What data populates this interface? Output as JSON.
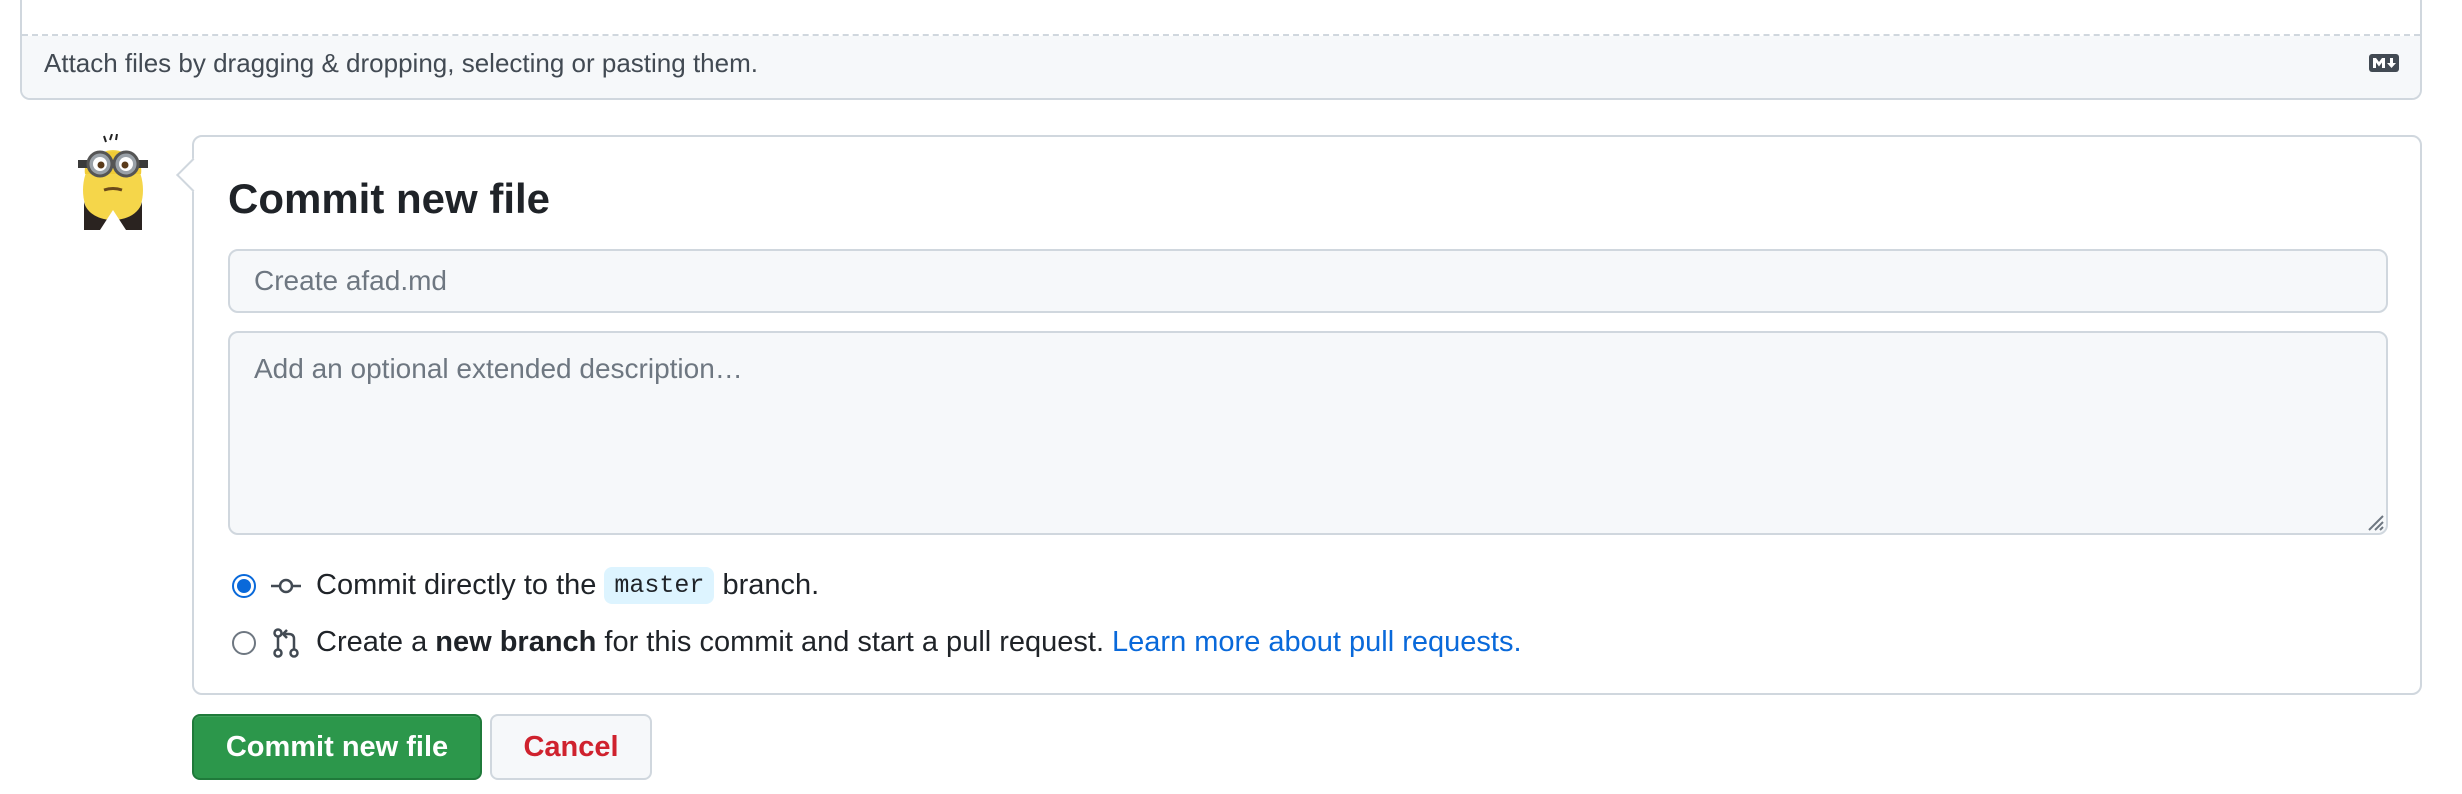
{
  "attach": {
    "text": "Attach files by dragging & dropping, selecting or pasting them.",
    "markdown_icon": "markdown-icon"
  },
  "avatar": {
    "icon": "minion-avatar-icon"
  },
  "commit": {
    "title": "Commit new file",
    "summary_placeholder": "Create afad.md",
    "summary_value": "",
    "description_placeholder": "Add an optional extended description…",
    "description_value": "",
    "option_direct": {
      "selected": true,
      "icon": "git-commit-icon",
      "text_before": "Commit directly to the",
      "branch": "master",
      "text_after": "branch."
    },
    "option_new_branch": {
      "selected": false,
      "icon": "git-pull-request-icon",
      "text_before": "Create a",
      "bold": "new branch",
      "text_after": "for this commit and start a pull request.",
      "link": "Learn more about pull requests."
    }
  },
  "actions": {
    "commit_label": "Commit new file",
    "cancel_label": "Cancel"
  },
  "colors": {
    "primary_button": "#2c974b",
    "cancel_text": "#cf222e",
    "link": "#0969da",
    "radio_selected": "#0969da",
    "branch_bg": "#ddf4ff",
    "border": "#d0d7de"
  }
}
